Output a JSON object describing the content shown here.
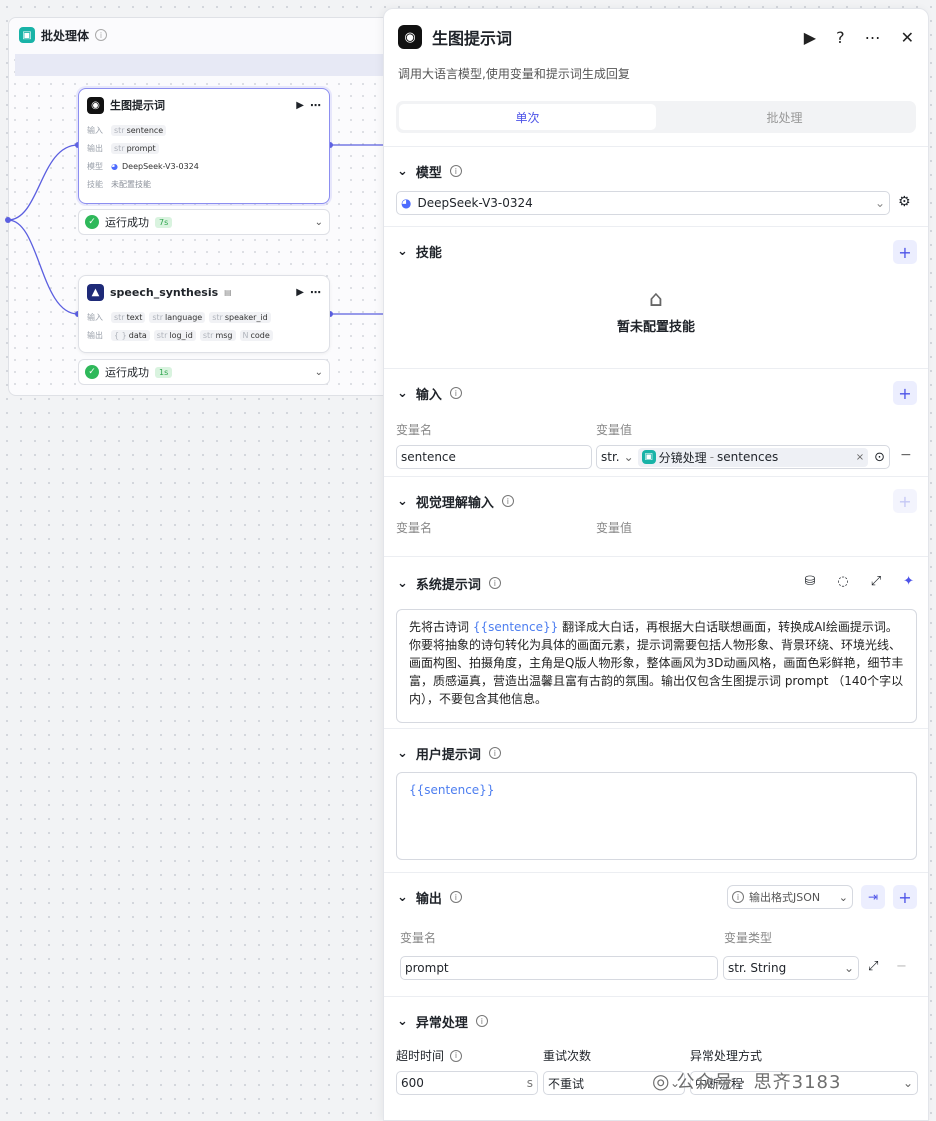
{
  "canvas": {
    "batch": {
      "title": "批处理体"
    },
    "node1": {
      "title": "生图提示词",
      "in_label": "输入",
      "in_tag": "sentence",
      "out_label": "输出",
      "out_tag": "prompt",
      "model_label": "模型",
      "model": "DeepSeek-V3-0324",
      "skill_label": "技能",
      "skill": "未配置技能",
      "status": "运行成功",
      "time": "7s"
    },
    "node2": {
      "title": "speech_synthesis",
      "in_label": "输入",
      "in_tags": [
        "text",
        "language",
        "speaker_id"
      ],
      "out_label": "输出",
      "out_tags": [
        "data",
        "log_id",
        "msg",
        "code"
      ],
      "status": "运行成功",
      "time": "1s"
    },
    "type_str": "str",
    "type_obj": "{ }",
    "type_num": "N"
  },
  "panel": {
    "title": "生图提示词",
    "description": "调用大语言模型,使用变量和提示词生成回复",
    "tabs": [
      "单次",
      "批处理"
    ],
    "model": {
      "title": "模型",
      "value": "DeepSeek-V3-0324"
    },
    "skills": {
      "title": "技能",
      "empty": "暂未配置技能"
    },
    "input": {
      "title": "输入",
      "col_name": "变量名",
      "col_value": "变量值",
      "name": "sentence",
      "type": "str.",
      "ref_node": "分镜处理",
      "ref_sep": " - ",
      "ref_var": "sentences"
    },
    "vision": {
      "title": "视觉理解输入",
      "col_name": "变量名",
      "col_value": "变量值"
    },
    "system_prompt": {
      "title": "系统提示词",
      "before": "先将古诗词 ",
      "var": "{{sentence}}",
      "after": " 翻译成大白话，再根据大白话联想画面，转换成AI绘画提示词。你要将抽象的诗句转化为具体的画面元素，提示词需要包括人物形象、背景环绕、环境光线、画面构图、拍摄角度，主角是Q版人物形象，整体画风为3D动画风格，画面色彩鲜艳，细节丰富，质感逼真，营造出温馨且富有古韵的氛围。输出仅包含生图提示词 prompt （140个字以内），不要包含其他信息。"
    },
    "user_prompt": {
      "title": "用户提示词",
      "value": "{{sentence}}"
    },
    "output": {
      "title": "输出",
      "format": "输出格式JSON",
      "col_name": "变量名",
      "col_type": "变量类型",
      "name": "prompt",
      "type": "str. String"
    },
    "exception": {
      "title": "异常处理",
      "timeout_label": "超时时间",
      "timeout": "600",
      "unit": "s",
      "retry_label": "重试次数",
      "retry": "不重试",
      "mode_label": "异常处理方式",
      "mode": "中断流程"
    }
  },
  "watermark": "公众号 · 思齐3183",
  "colors": {
    "accent": "#4d53e8",
    "success": "#2fb85a",
    "teal": "#18b3a7"
  }
}
